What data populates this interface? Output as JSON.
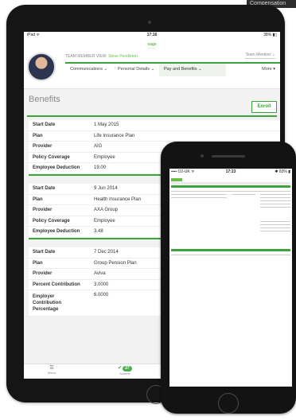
{
  "corner": {
    "text": "Compensation"
  },
  "tablet": {
    "status": {
      "left": "iPad ᯤ",
      "time": "17:16",
      "battery": "38% ▮▯"
    },
    "app": {
      "logo_title": "sage",
      "logo_sub": "People"
    },
    "header": {
      "viewing_label": "TEAM MEMBER VIEW:",
      "viewing_name": "Steve Pendleton",
      "role_select": "Team Member",
      "tabs": [
        {
          "label": "Communications"
        },
        {
          "label": "Personal Details"
        },
        {
          "label": "Pay and Benefits"
        },
        {
          "label": "More"
        }
      ]
    },
    "page": {
      "title": "Benefits",
      "enroll_label": "Enroll"
    },
    "benefits": [
      {
        "rows": [
          {
            "label": "Start Date",
            "value": "1 May 2015"
          },
          {
            "label": "Plan",
            "value": "Life Insurance Plan"
          },
          {
            "label": "Provider",
            "value": "AIG"
          },
          {
            "label": "Policy Coverage",
            "value": "Employee"
          },
          {
            "label": "Employee Deduction",
            "value": "19.00"
          }
        ]
      },
      {
        "rows": [
          {
            "label": "Start Date",
            "value": "9 Jun 2014"
          },
          {
            "label": "Plan",
            "value": "Health Insurance Plan"
          },
          {
            "label": "Provider",
            "value": "AXA Group"
          },
          {
            "label": "Policy Coverage",
            "value": "Employee"
          },
          {
            "label": "Employee Deduction",
            "value": "3.48"
          }
        ]
      },
      {
        "rows": [
          {
            "label": "Start Date",
            "value": "7 Dec 2014"
          },
          {
            "label": "Plan",
            "value": "Group Pension Plan"
          },
          {
            "label": "Provider",
            "value": "Aviva"
          },
          {
            "label": "Percent Contribution",
            "value": "3.0000"
          },
          {
            "label": "Employer Contribution Percentage",
            "value": "6.0000"
          }
        ]
      }
    ],
    "bottom": {
      "menu_label": "Menu",
      "menu_glyph": "☰",
      "actions_label": "Actions",
      "actions_check": "✔",
      "actions_count": "27"
    }
  },
  "phone": {
    "status": {
      "left": "▪▪▪▪ O2-UK ᯤ",
      "time": "17:23",
      "right": "✱ 83% ▮"
    }
  }
}
